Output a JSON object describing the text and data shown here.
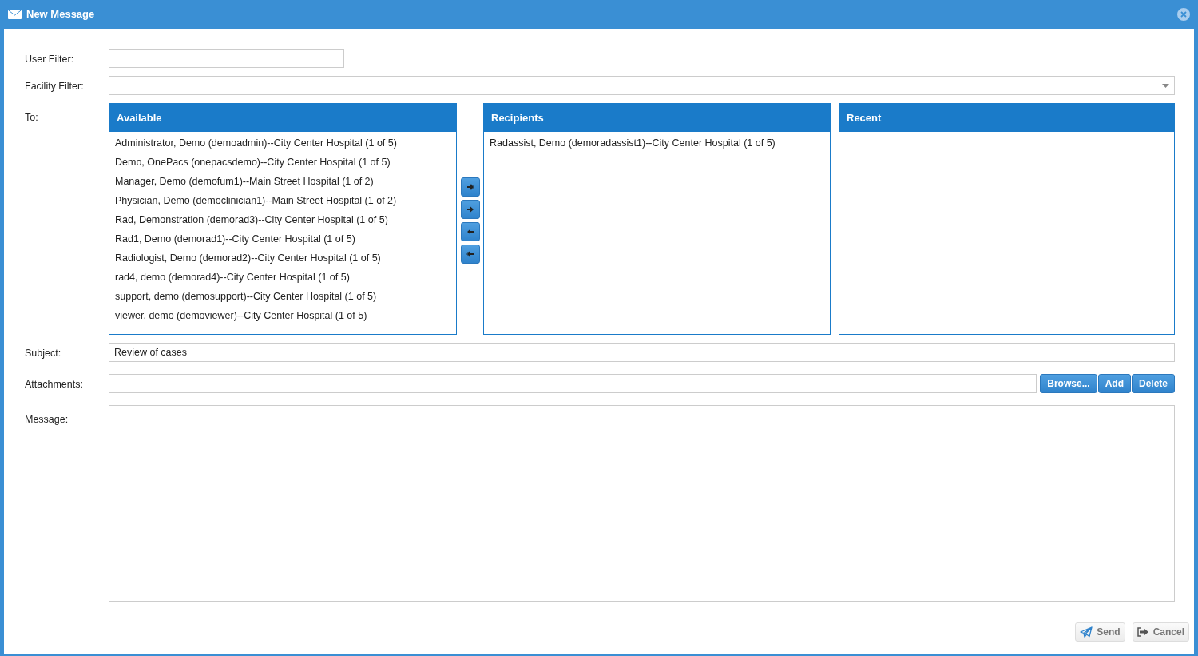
{
  "window": {
    "title": "New Message"
  },
  "user_filter": {
    "label": "User Filter:"
  },
  "facility_filter": {
    "label": "Facility Filter:"
  },
  "to": {
    "label": "To:",
    "available": {
      "title": "Available",
      "items": [
        {
          "text": "Administrator, Demo (demoadmin)--City Center Hospital (1 of 5)",
          "selected": false
        },
        {
          "text": "Demo, OnePacs (onepacsdemo)--City Center Hospital (1 of 5)",
          "selected": false
        },
        {
          "text": "Manager, Demo (demofum1)--Main Street Hospital (1 of 2)",
          "selected": false
        },
        {
          "text": "Physician, Demo (democlinician1)--Main Street Hospital (1 of 2)",
          "selected": false
        },
        {
          "text": "Rad, Demonstration (demorad3)--City Center Hospital (1 of 5)",
          "selected": false
        },
        {
          "text": "Rad1, Demo (demorad1)--City Center Hospital (1 of 5)",
          "selected": false
        },
        {
          "text": "Radiologist, Demo (demorad2)--City Center Hospital (1 of 5)",
          "selected": false
        },
        {
          "text": "rad4, demo (demorad4)--City Center Hospital (1 of 5)",
          "selected": false
        },
        {
          "text": "support, demo (demosupport)--City Center Hospital (1 of 5)",
          "selected": false
        },
        {
          "text": "viewer, demo (demoviewer)--City Center Hospital (1 of 5)",
          "selected": false
        }
      ]
    },
    "move_buttons": [
      {
        "kind": "all-right"
      },
      {
        "kind": "right"
      },
      {
        "kind": "left"
      },
      {
        "kind": "all-left"
      }
    ],
    "recipients": {
      "title": "Recipients",
      "items": [
        {
          "text": "Radassist, Demo (demoradassist1)--City Center Hospital (1 of 5)",
          "selected": false
        }
      ]
    },
    "recent": {
      "title": "Recent"
    }
  },
  "subject": {
    "label": "Subject:",
    "value": "Review of cases"
  },
  "attachments": {
    "label": "Attachments:",
    "buttons": [
      "Browse...",
      "Add",
      "Delete"
    ]
  },
  "message": {
    "label": "Message:"
  },
  "footer_buttons": [
    {
      "kind": "send",
      "label": "Send",
      "disabled": true
    },
    {
      "kind": "cancel",
      "label": "Cancel",
      "disabled": true
    }
  ]
}
